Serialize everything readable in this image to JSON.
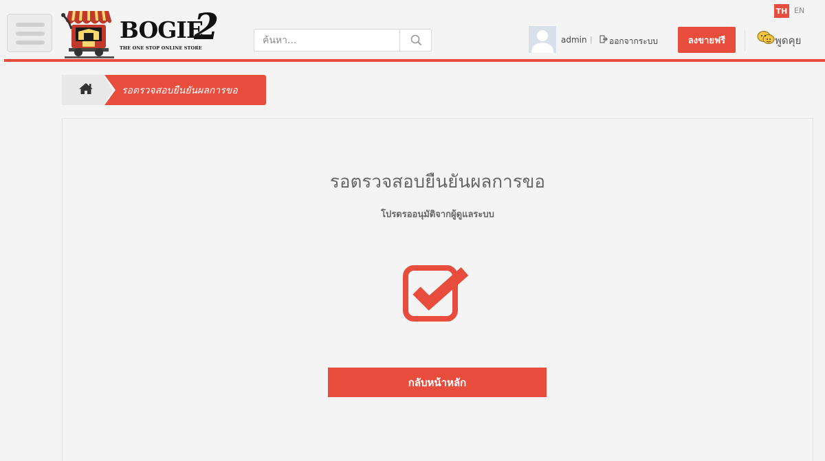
{
  "header": {
    "logo_text": "BOGIE",
    "logo_number": "2",
    "logo_tagline": "THE ONE STOP ONLINE STORE",
    "search_placeholder": "ค้นหา...",
    "username": "admin",
    "separator": "|",
    "logout_label": "ออกจากระบบ",
    "sell_label": "ลงขายฟรี",
    "chat_label": "พูดคุย",
    "languages": [
      "TH",
      "EN"
    ],
    "active_language": "TH"
  },
  "breadcrumb": {
    "current_label": "รอตรวจสอบยืนยันผลการขอ"
  },
  "main": {
    "title": "รอตรวจสอบยืนยันผลการขอ",
    "subtitle": "โปรดรออนุมัติจากผู้ดูแลระบบ",
    "status_icon": "checked-box-icon",
    "back_button_label": "กลับหน้าหลัก"
  },
  "colors": {
    "accent": "#e74c3c",
    "background": "#f4f4f4"
  }
}
